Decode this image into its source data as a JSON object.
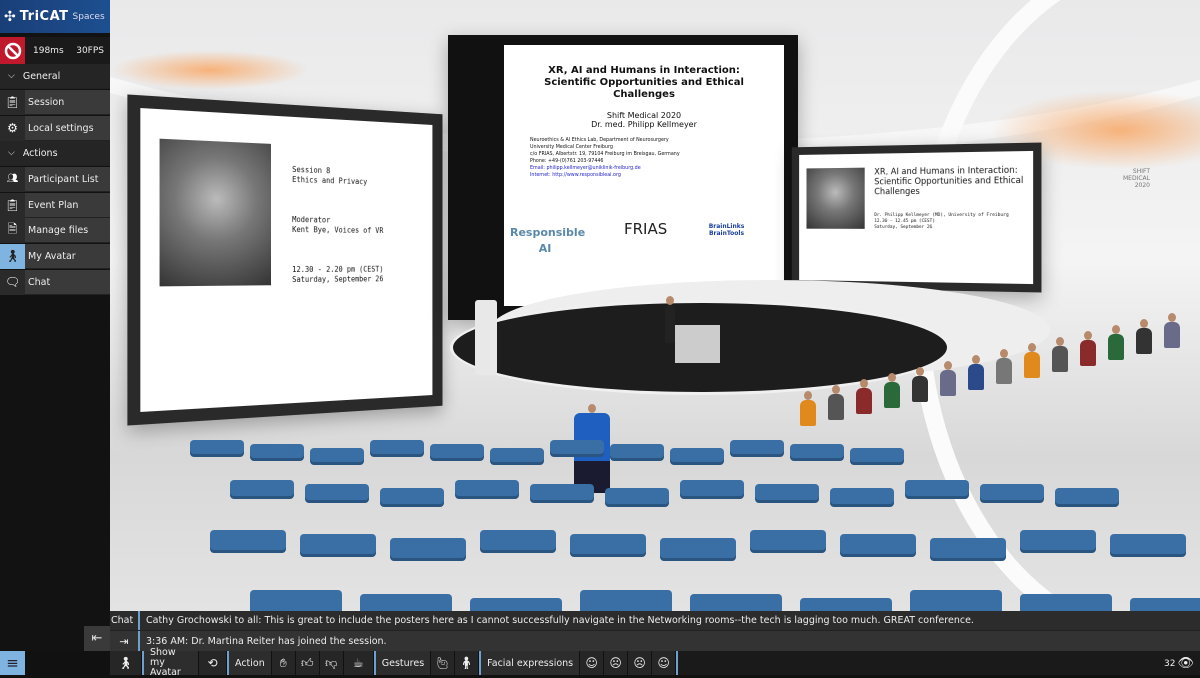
{
  "app": {
    "logo_text": "TriCAT",
    "logo_sub": "Spaces"
  },
  "status": {
    "latency": "198ms",
    "fps": "30FPS",
    "icon": "no-entry-icon",
    "icon_color": "#c0192b"
  },
  "sidebar": {
    "sections": [
      {
        "label": "General",
        "items": [
          {
            "label": "Session",
            "icon": "clipboard-icon"
          },
          {
            "label": "Local settings",
            "icon": "gear-icon"
          }
        ]
      },
      {
        "label": "Actions",
        "items": [
          {
            "label": "Participant List",
            "icon": "people-icon"
          },
          {
            "label": "Event Plan",
            "icon": "clipboard-icon"
          },
          {
            "label": "Manage files",
            "icon": "file-icon"
          },
          {
            "label": "My Avatar",
            "icon": "avatar-icon",
            "active": true
          },
          {
            "label": "Chat",
            "icon": "chat-icon"
          }
        ]
      }
    ]
  },
  "chat": {
    "label": "Chat",
    "message": "Cathy Grochowski to all: This is great to include the posters here as I cannot successfully navigate in the Networking rooms--the tech is lagging too much.  GREAT conference.",
    "system_message": "3:36 AM: Dr. Martina Reiter has joined the session."
  },
  "toolbar": {
    "show_avatar": "Show my Avatar",
    "action": "Action",
    "gestures": "Gestures",
    "facial": "Facial expressions",
    "viewer_count": "32"
  },
  "scene": {
    "screen_a": {
      "label": "A",
      "title": "XR, AI and Humans in Interaction: Scientific Opportunities and Ethical Challenges",
      "event": "Shift Medical 2020",
      "speaker": "Dr. med. Philipp Kellmeyer",
      "lines": [
        "Neuroethics & AI Ethics Lab, Department of Neurosurgery",
        "University Medical Center Freiburg",
        "c/o FRIAS, Albertstr. 19, 79104 Freiburg im Breisgau, Germany",
        "Phone: +49-(0)761 203-97446",
        "Email: philipp.kellmeyer@uniklinik-freiburg.de",
        "Internet: http://www.responsibleai.org"
      ],
      "logo1": "Responsible AI",
      "logo2": "FRIAS",
      "logo3": "BrainLinks BrainTools"
    },
    "screen_b": {
      "label": "B",
      "lines": [
        "Session 8",
        "Ethics and Privacy",
        "",
        "Moderator",
        "Kent Bye, Voices of VR",
        "",
        "12.30 - 2.20 pm (CEST)",
        "Saturday, September 26"
      ]
    },
    "screen_c": {
      "label": "C",
      "title": "XR, AI and Humans in Interaction: Scientific Opportunities and Ethical Challenges",
      "lines": [
        "Dr. Philipp Kellmeyer (MD), University of Freiburg",
        "12.30 - 12.45 pm (CEST)",
        "Saturday, September 26"
      ]
    },
    "wall_text": "SHIFT MEDICAL 2020",
    "seat_color": "#3a6fa5"
  }
}
